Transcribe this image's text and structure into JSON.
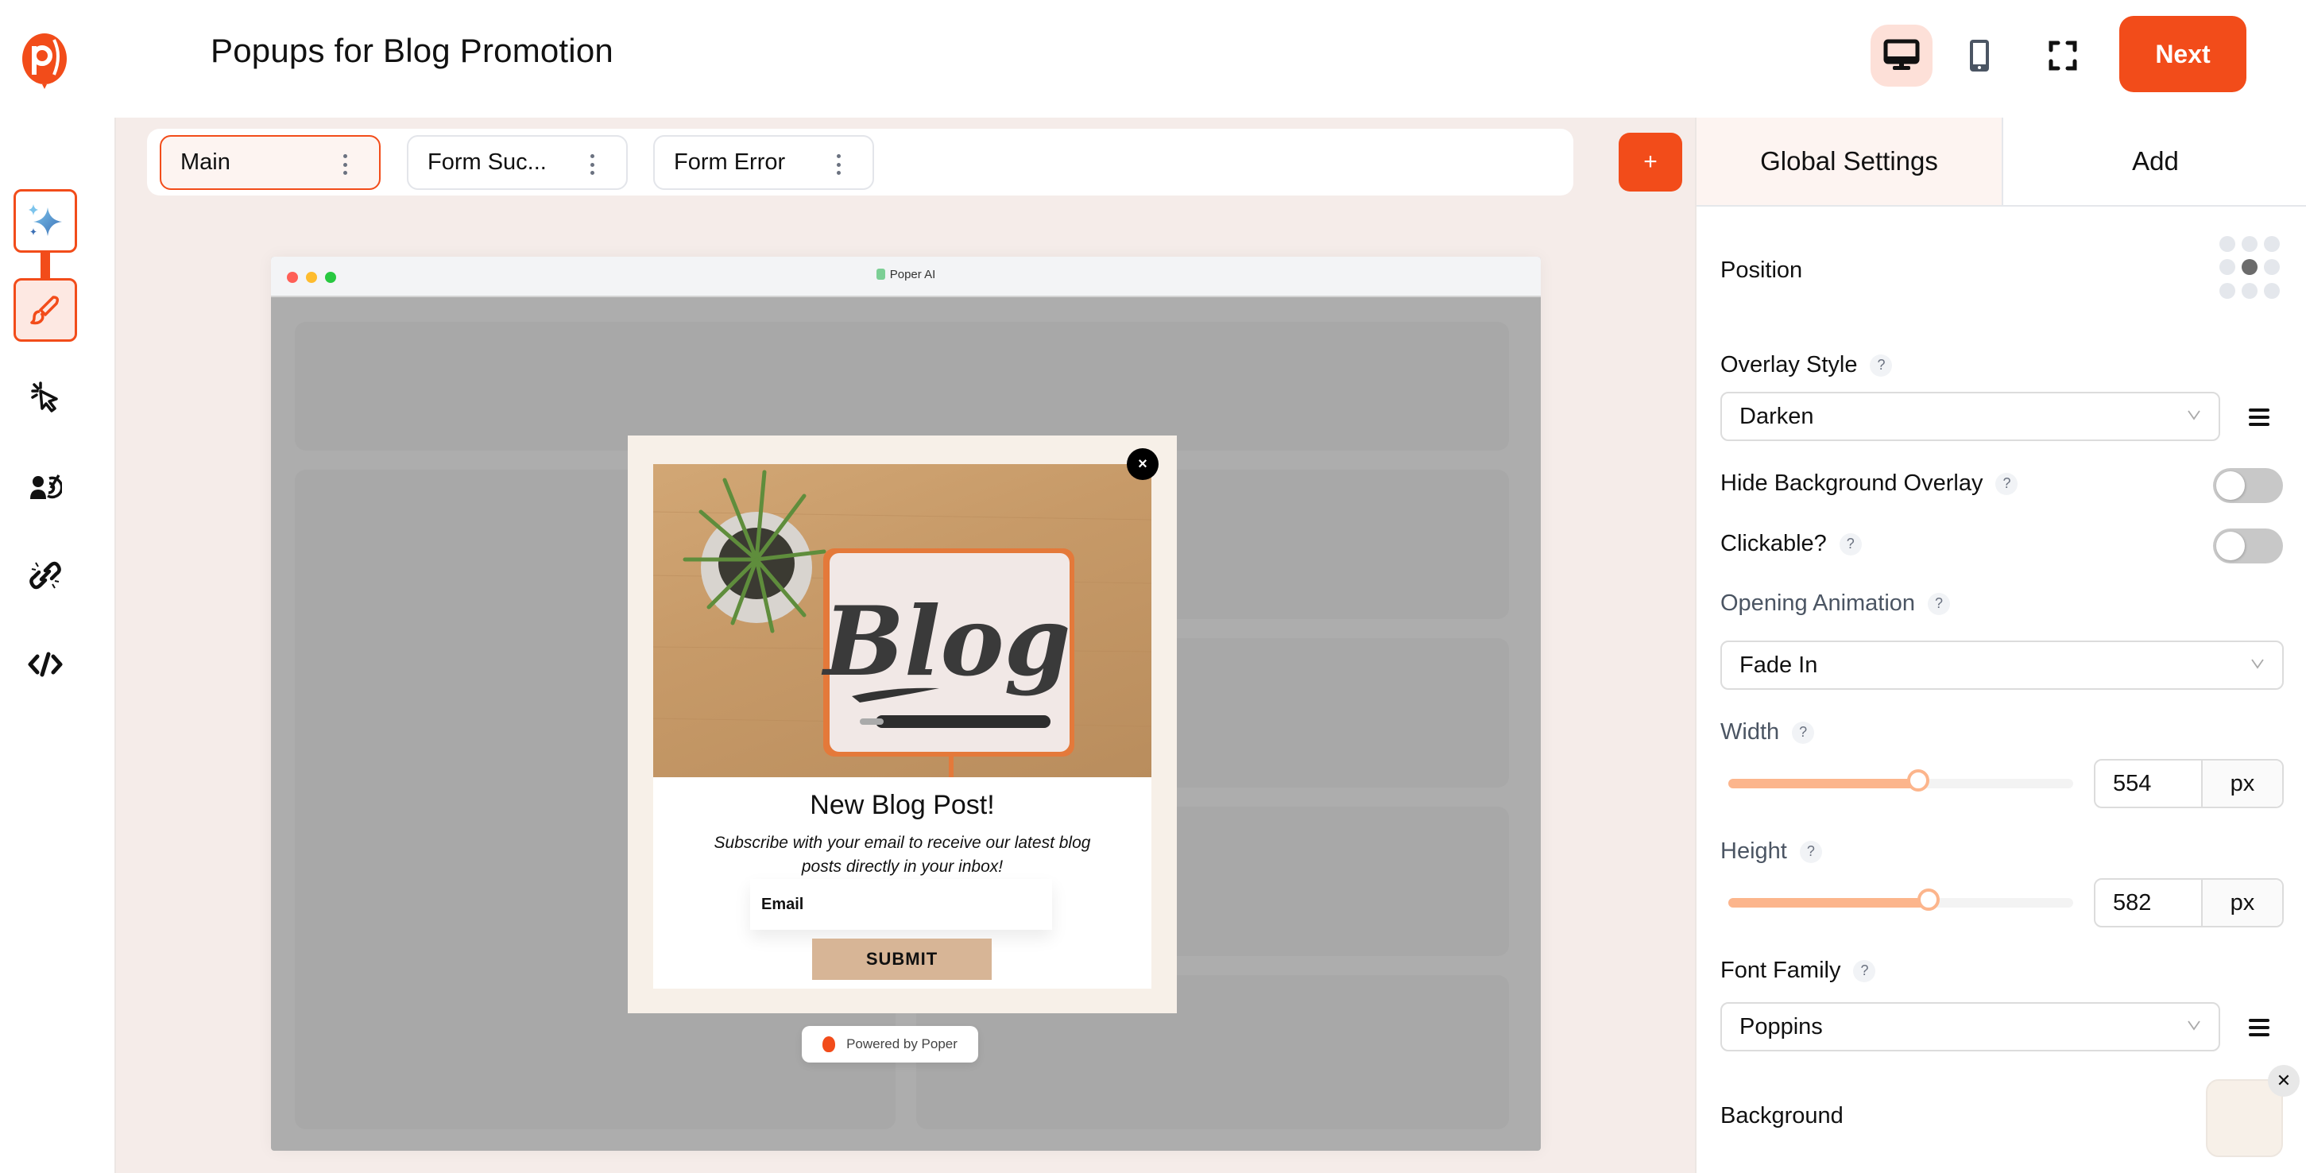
{
  "header": {
    "title": "Popups for Blog Promotion",
    "next_label": "Next",
    "devices": [
      {
        "name": "desktop",
        "icon": "desktop-icon",
        "active": true
      },
      {
        "name": "mobile",
        "icon": "mobile-icon",
        "active": false
      },
      {
        "name": "fullscreen",
        "icon": "fullscreen-icon",
        "active": false
      }
    ]
  },
  "sidebar": {
    "items": [
      {
        "icon": "ai-sparkle-icon",
        "state": "outlined"
      },
      {
        "icon": "paintbrush-icon",
        "state": "active"
      },
      {
        "icon": "click-cursor-icon",
        "state": "default"
      },
      {
        "icon": "audience-target-icon",
        "state": "default"
      },
      {
        "icon": "link-icon",
        "state": "default"
      },
      {
        "icon": "code-icon",
        "state": "default"
      }
    ]
  },
  "screens": {
    "tabs": [
      {
        "label": "Main",
        "active": true
      },
      {
        "label": "Form Suc...",
        "active": false
      },
      {
        "label": "Form Error",
        "active": false
      }
    ],
    "add_label": "+"
  },
  "preview": {
    "browser_title": "Poper AI",
    "popup": {
      "close_label": "×",
      "heading": "New Blog Post!",
      "subtext": "Subscribe with your email to receive our latest blog posts directly in your inbox!",
      "email_placeholder": "Email",
      "submit_label": "SUBMIT",
      "image_text": "Blog"
    },
    "powered_by": "Powered by Poper"
  },
  "panel": {
    "tabs": [
      {
        "label": "Global Settings",
        "active": true
      },
      {
        "label": "Add",
        "active": false
      }
    ],
    "position_label": "Position",
    "position_selected": "center",
    "overlay_style": {
      "label": "Overlay Style",
      "value": "Darken",
      "help": "?"
    },
    "hide_bg_overlay": {
      "label": "Hide Background Overlay",
      "help": "?",
      "on": false
    },
    "clickable": {
      "label": "Clickable?",
      "help": "?",
      "on": false
    },
    "opening_animation": {
      "label": "Opening Animation",
      "value": "Fade In",
      "help": "?"
    },
    "width": {
      "label": "Width",
      "help": "?",
      "value": "554",
      "unit": "px",
      "slider_fraction": 0.55
    },
    "height": {
      "label": "Height",
      "help": "?",
      "value": "582",
      "unit": "px",
      "slider_fraction": 0.58
    },
    "font_family": {
      "label": "Font Family",
      "value": "Poppins",
      "help": "?"
    },
    "background": {
      "label": "Background",
      "color": "#f7f0e8",
      "clear_label": "✕"
    }
  },
  "colors": {
    "accent": "#f24c1a",
    "canvas_bg": "#f5ece9",
    "slider": "#fcb58c",
    "submit_bg": "#d7b596"
  }
}
